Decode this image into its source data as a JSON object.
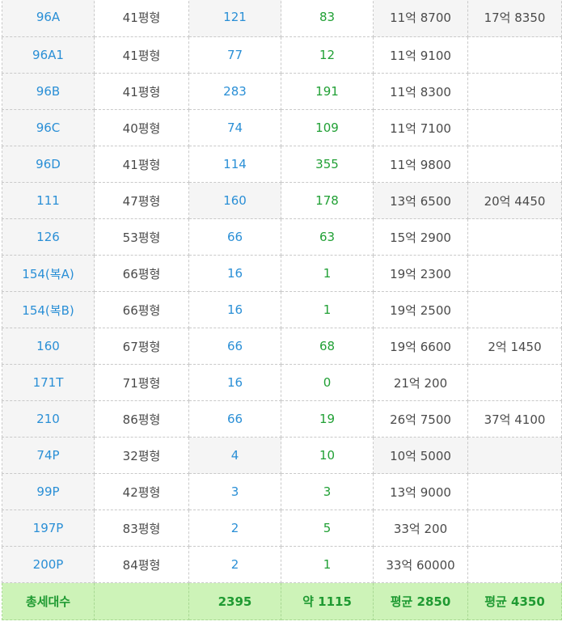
{
  "rows": [
    {
      "name": "96A",
      "pyeong": "41평형",
      "units": "121",
      "count": "83",
      "price": "11억 8700",
      "max": "17억 8350",
      "shade": [
        true,
        false,
        true,
        true
      ]
    },
    {
      "name": "96A1",
      "pyeong": "41평형",
      "units": "77",
      "count": "12",
      "price": "11억 9100",
      "max": "",
      "shade": [
        false,
        false,
        false,
        false
      ]
    },
    {
      "name": "96B",
      "pyeong": "41평형",
      "units": "283",
      "count": "191",
      "price": "11억 8300",
      "max": "",
      "shade": [
        false,
        false,
        false,
        false
      ]
    },
    {
      "name": "96C",
      "pyeong": "40평형",
      "units": "74",
      "count": "109",
      "price": "11억 7100",
      "max": "",
      "shade": [
        false,
        false,
        false,
        false
      ]
    },
    {
      "name": "96D",
      "pyeong": "41평형",
      "units": "114",
      "count": "355",
      "price": "11억 9800",
      "max": "",
      "shade": [
        false,
        false,
        false,
        false
      ]
    },
    {
      "name": "111",
      "pyeong": "47평형",
      "units": "160",
      "count": "178",
      "price": "13억 6500",
      "max": "20억 4450",
      "shade": [
        true,
        false,
        true,
        true
      ]
    },
    {
      "name": "126",
      "pyeong": "53평형",
      "units": "66",
      "count": "63",
      "price": "15억 2900",
      "max": "",
      "shade": [
        false,
        false,
        false,
        false
      ]
    },
    {
      "name": "154(복A)",
      "pyeong": "66평형",
      "units": "16",
      "count": "1",
      "price": "19억 2300",
      "max": "",
      "shade": [
        false,
        false,
        false,
        false
      ]
    },
    {
      "name": "154(복B)",
      "pyeong": "66평형",
      "units": "16",
      "count": "1",
      "price": "19억 2500",
      "max": "",
      "shade": [
        false,
        false,
        false,
        false
      ]
    },
    {
      "name": "160",
      "pyeong": "67평형",
      "units": "66",
      "count": "68",
      "price": "19억 6600",
      "max": "2억 1450",
      "shade": [
        false,
        false,
        false,
        false
      ]
    },
    {
      "name": "171T",
      "pyeong": "71평형",
      "units": "16",
      "count": "0",
      "price": "21억 200",
      "max": "",
      "shade": [
        false,
        false,
        false,
        false
      ]
    },
    {
      "name": "210",
      "pyeong": "86평형",
      "units": "66",
      "count": "19",
      "price": "26억 7500",
      "max": "37억 4100",
      "shade": [
        false,
        false,
        false,
        false
      ]
    },
    {
      "name": "74P",
      "pyeong": "32평형",
      "units": "4",
      "count": "10",
      "price": "10억 5000",
      "max": "",
      "shade": [
        true,
        true,
        true,
        true
      ]
    },
    {
      "name": "99P",
      "pyeong": "42평형",
      "units": "3",
      "count": "3",
      "price": "13억 9000",
      "max": "",
      "shade": [
        false,
        false,
        false,
        false
      ]
    },
    {
      "name": "197P",
      "pyeong": "83평형",
      "units": "2",
      "count": "5",
      "price": "33억 200",
      "max": "",
      "shade": [
        false,
        false,
        false,
        false
      ]
    },
    {
      "name": "200P",
      "pyeong": "84평형",
      "units": "2",
      "count": "1",
      "price": "33억 60000",
      "max": "",
      "shade": [
        false,
        false,
        false,
        false
      ]
    }
  ],
  "total": {
    "label": "총세대수",
    "blank": "",
    "units": "2395",
    "count": "약 1115",
    "avg_price": "평균 2850",
    "avg_max": "평균 4350"
  },
  "colors": {
    "blue": "#2a8fd6",
    "green": "#21a035",
    "total_bg": "#cdf3b8",
    "shade_bg": "#f5f5f5"
  }
}
